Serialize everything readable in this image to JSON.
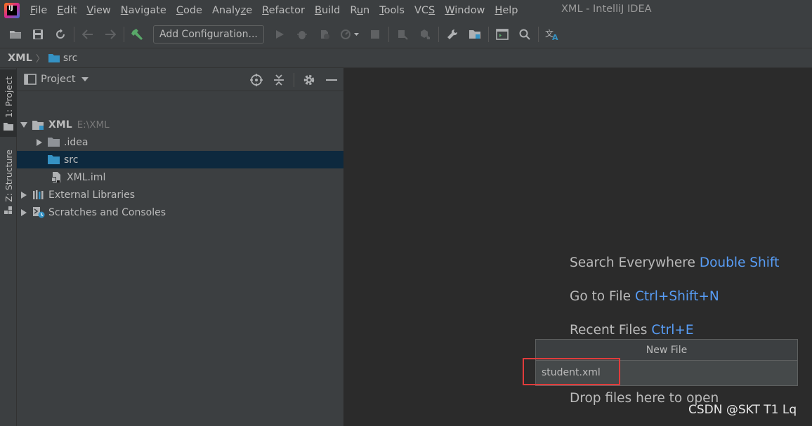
{
  "menubar": {
    "items": [
      {
        "label": "File",
        "mnemonic": "F"
      },
      {
        "label": "Edit",
        "mnemonic": "E"
      },
      {
        "label": "View",
        "mnemonic": "V"
      },
      {
        "label": "Navigate",
        "mnemonic": "N"
      },
      {
        "label": "Code",
        "mnemonic": "C"
      },
      {
        "label": "Analyze",
        "mnemonic": "z"
      },
      {
        "label": "Refactor",
        "mnemonic": "R"
      },
      {
        "label": "Build",
        "mnemonic": "B"
      },
      {
        "label": "Run",
        "mnemonic": "u"
      },
      {
        "label": "Tools",
        "mnemonic": "T"
      },
      {
        "label": "VCS",
        "mnemonic": "S"
      },
      {
        "label": "Window",
        "mnemonic": "W"
      },
      {
        "label": "Help",
        "mnemonic": "H"
      }
    ],
    "window_title": "XML - IntelliJ IDEA"
  },
  "toolbar": {
    "config_label": "Add Configuration..."
  },
  "breadcrumb": {
    "root": "XML",
    "folder": "src"
  },
  "left_strip": {
    "project_tab": "1: Project",
    "structure_tab": "Z: Structure"
  },
  "project_panel": {
    "title": "Project",
    "tree": [
      {
        "label": "XML",
        "path": "E:\\XML",
        "expanded": true,
        "icon": "module-folder-icon"
      },
      {
        "label": ".idea",
        "expanded": false,
        "icon": "folder-icon"
      },
      {
        "label": "src",
        "selected": true,
        "icon": "source-folder-icon"
      },
      {
        "label": "XML.iml",
        "icon": "iml-file-icon"
      },
      {
        "label": "External Libraries",
        "expanded": false,
        "icon": "library-icon"
      },
      {
        "label": "Scratches and Consoles",
        "expanded": false,
        "icon": "scratches-icon"
      }
    ]
  },
  "editor": {
    "hints": [
      {
        "label": "Search Everywhere",
        "shortcut": "Double Shift"
      },
      {
        "label": "Go to File",
        "shortcut": "Ctrl+Shift+N"
      },
      {
        "label": "Recent Files",
        "shortcut": "Ctrl+E"
      },
      {
        "label": "Drop files here to open",
        "shortcut": ""
      }
    ]
  },
  "new_file_popup": {
    "title": "New File",
    "value": "student.xml"
  },
  "watermark": "CSDN @SKT T1 Lq",
  "colors": {
    "background": "#2b2b2b",
    "panel": "#3c3f41",
    "selection": "#0d293e",
    "shortcut": "#589df6",
    "highlight": "#e03c3c"
  }
}
